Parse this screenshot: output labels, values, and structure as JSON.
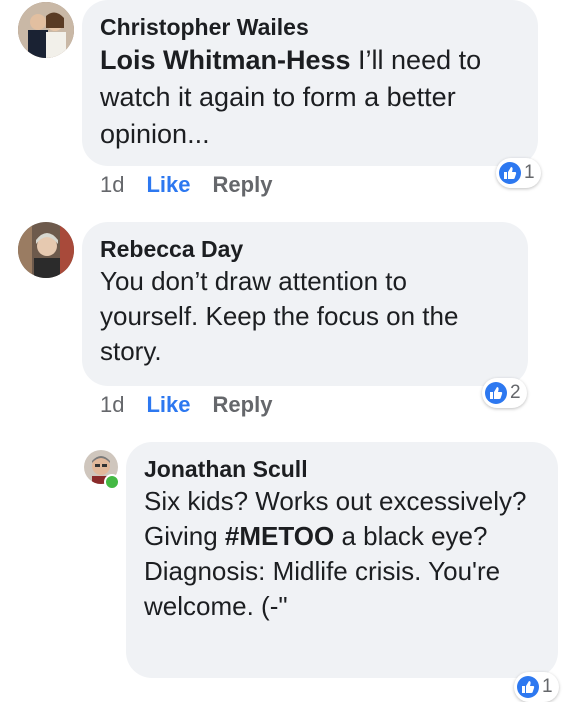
{
  "comments": [
    {
      "author": "Christopher Wailes",
      "mention": "Lois Whitman-Hess",
      "text": " I’ll need to watch it again to form a better opinion...",
      "time": "1d",
      "like_label": "Like",
      "reply_label": "Reply",
      "reaction_count": "1"
    },
    {
      "author": "Rebecca Day",
      "text": "You don’t draw attention to yourself. Keep the focus on the story.",
      "time": "1d",
      "like_label": "Like",
      "reply_label": "Reply",
      "reaction_count": "2"
    },
    {
      "author": "Jonathan Scull",
      "text_before": "Six kids? Works out excessively? Giving ",
      "hashtag": "#METOO",
      "text_after": " a black eye? Diagnosis: Midlife crisis. You're welcome. (-\"",
      "reaction_count": "1"
    }
  ],
  "colors": {
    "accent": "#2d78f0",
    "bubble": "#f0f2f5",
    "meta": "#65676b",
    "online": "#44b944"
  },
  "icons": [
    "like-thumb-icon",
    "avatar",
    "online-status-icon"
  ]
}
